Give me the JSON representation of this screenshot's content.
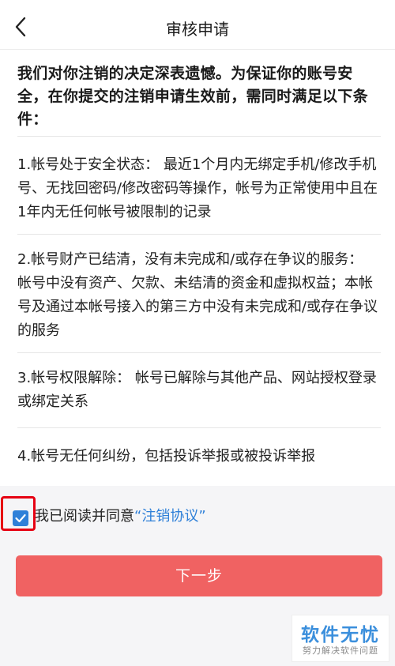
{
  "header": {
    "title": "审核申请"
  },
  "intro": "我们对你注销的决定深表遗憾。为保证你的账号安全，在你提交的注销申请生效前，需同时满足以下条件：",
  "conditions": [
    "1.帐号处于安全状态： 最近1个月内无绑定手机/修改手机号、无找回密码/修改密码等操作，帐号为正常使用中且在1年内无任何帐号被限制的记录",
    "2.帐号财产已结清，没有未完成和/或存在争议的服务： 帐号中没有资产、欠款、未结清的资金和虚拟权益；本帐号及通过本帐号接入的第三方中没有未完成和/或存在争议的服务",
    "3.帐号权限解除： 帐号已解除与其他产品、网站授权登录或绑定关系",
    "4.帐号无任何纠纷，包括投诉举报或被投诉举报"
  ],
  "agreement": {
    "checked": true,
    "text": "我已阅读并同意",
    "link": "“注销协议”"
  },
  "next_button": "下一步",
  "watermark": {
    "title": "软件无忧",
    "subtitle": "努力解决软件问题"
  },
  "colors": {
    "accent": "#2f80d8",
    "button": "#f06262",
    "highlight": "#e60012"
  }
}
